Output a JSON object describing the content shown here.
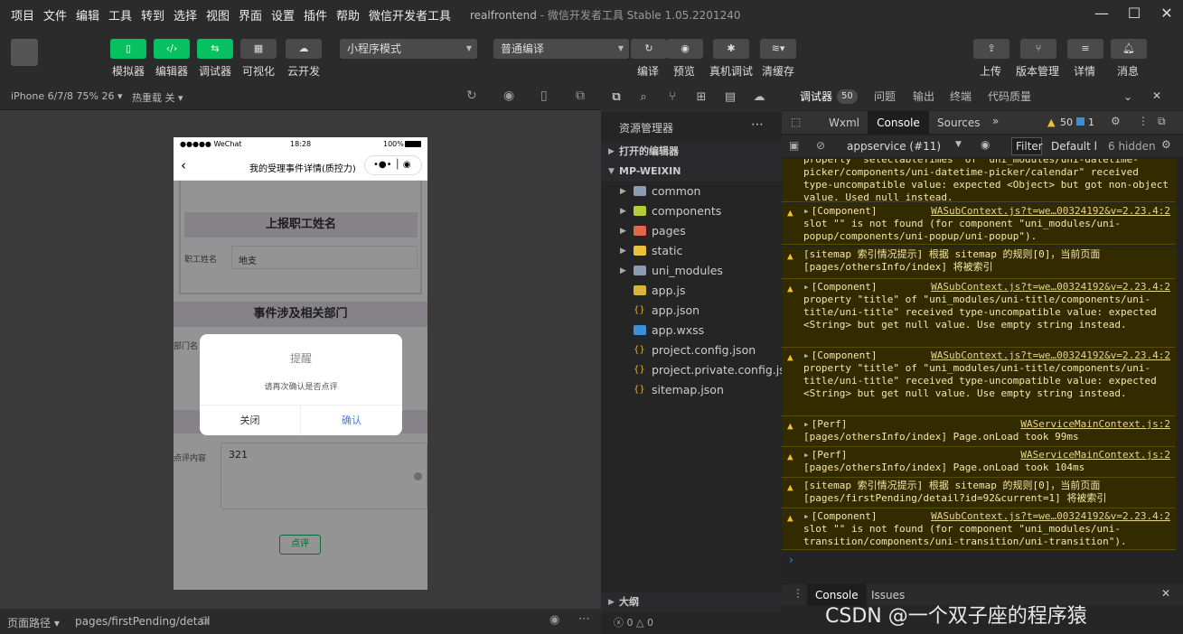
{
  "menubar": {
    "items": [
      "项目",
      "文件",
      "编辑",
      "工具",
      "转到",
      "选择",
      "视图",
      "界面",
      "设置",
      "插件",
      "帮助",
      "微信开发者工具"
    ],
    "title_project": "realfrontend",
    "title_rest": " - 微信开发者工具 Stable 1.05.2201240"
  },
  "toolbar": {
    "simulator": "模拟器",
    "editor": "编辑器",
    "debugger": "调试器",
    "visual": "可视化",
    "cloud": "云开发",
    "mode_select": "小程序模式",
    "compile_select": "普通编译",
    "compile": "编译",
    "preview": "预览",
    "real_debug": "真机调试",
    "clear_cache": "清缓存",
    "upload": "上传",
    "version": "版本管理",
    "details": "详情",
    "messages": "消息"
  },
  "simulator": {
    "device": "iPhone 6/7/8 75% 26",
    "hot_reload": "热重载 关",
    "status_carrier": "●●●●● WeChat",
    "status_time": "18:28",
    "status_battery": "100%",
    "nav_title": "我的受理事件详情(质控力)",
    "section1": "上报职工姓名",
    "field_label": "职工姓名",
    "field_value": "地支",
    "section2": "事件涉及相关部门",
    "dept_label": "部门名",
    "modal_title": "提醒",
    "modal_content": "请再次确认是否点评",
    "modal_cancel": "关闭",
    "modal_confirm": "确认",
    "comment_label": "点评内容",
    "comment_value": "321",
    "comment_button": "点评"
  },
  "footer": {
    "path_label": "页面路径",
    "path_value": "pages/firstPending/detail",
    "errors": "0",
    "warnings": "0"
  },
  "explorer": {
    "title": "资源管理器",
    "open_editors": "打开的编辑器",
    "project": "MP-WEIXIN",
    "folders": [
      "common",
      "components",
      "pages",
      "static",
      "uni_modules"
    ],
    "files": [
      "app.js",
      "app.json",
      "app.wxss",
      "project.config.json",
      "project.private.config.js...",
      "sitemap.json"
    ],
    "outline": "大纲"
  },
  "devtools": {
    "tabs": [
      "调试器",
      "问题",
      "输出",
      "终端",
      "代码质量"
    ],
    "debugger_badge": "50",
    "inner_tabs": [
      "Wxml",
      "Console",
      "Sources"
    ],
    "warn_count": "50",
    "info_count": "1",
    "context": "appservice (#11)",
    "filter": "Filter",
    "levels": "Default l",
    "hidden": "6 hidden",
    "bottom_tabs": [
      "Console",
      "Issues"
    ],
    "watermark": "CSDN @一个双子座的程序猿",
    "logs": [
      {
        "src": "",
        "text": "property \"selectableTimes\" of \"uni_modules/uni-datetime-picker/components/uni-datetime-picker/calendar\" received type-uncompatible value: expected <Object> but got non-object value. Used null instead."
      },
      {
        "tag": "[Component]",
        "src": "WASubContext.js?t=we…00324192&v=2.23.4:2",
        "text": "slot \"\" is not found (for component \"uni_modules/uni-popup/components/uni-popup/uni-popup\")."
      },
      {
        "tag": "",
        "src": "",
        "text": "[sitemap 索引情况提示] 根据 sitemap 的规则[0]，当前页面 [pages/othersInfo/index] 将被索引"
      },
      {
        "tag": "[Component]",
        "src": "WASubContext.js?t=we…00324192&v=2.23.4:2",
        "text": "property \"title\" of \"uni_modules/uni-title/components/uni-title/uni-title\" received type-uncompatible value: expected <String> but get null value. Use empty string instead."
      },
      {
        "tag": "[Component]",
        "src": "WASubContext.js?t=we…00324192&v=2.23.4:2",
        "text": "property \"title\" of \"uni_modules/uni-title/components/uni-title/uni-title\" received type-uncompatible value: expected <String> but get null value. Use empty string instead."
      },
      {
        "tag": "[Perf]",
        "src": "WAServiceMainContext.js:2",
        "text": "[pages/othersInfo/index] Page.onLoad took 99ms"
      },
      {
        "tag": "[Perf]",
        "src": "WAServiceMainContext.js:2",
        "text": "[pages/othersInfo/index] Page.onLoad took 104ms"
      },
      {
        "tag": "",
        "src": "",
        "text": "[sitemap 索引情况提示] 根据 sitemap 的规则[0]，当前页面 [pages/firstPending/detail?id=92&current=1] 将被索引"
      },
      {
        "tag": "[Component]",
        "src": "WASubContext.js?t=we…00324192&v=2.23.4:2",
        "text": "slot \"\" is not found (for component \"uni_modules/uni-transition/components/uni-transition/uni-transition\")."
      }
    ]
  }
}
